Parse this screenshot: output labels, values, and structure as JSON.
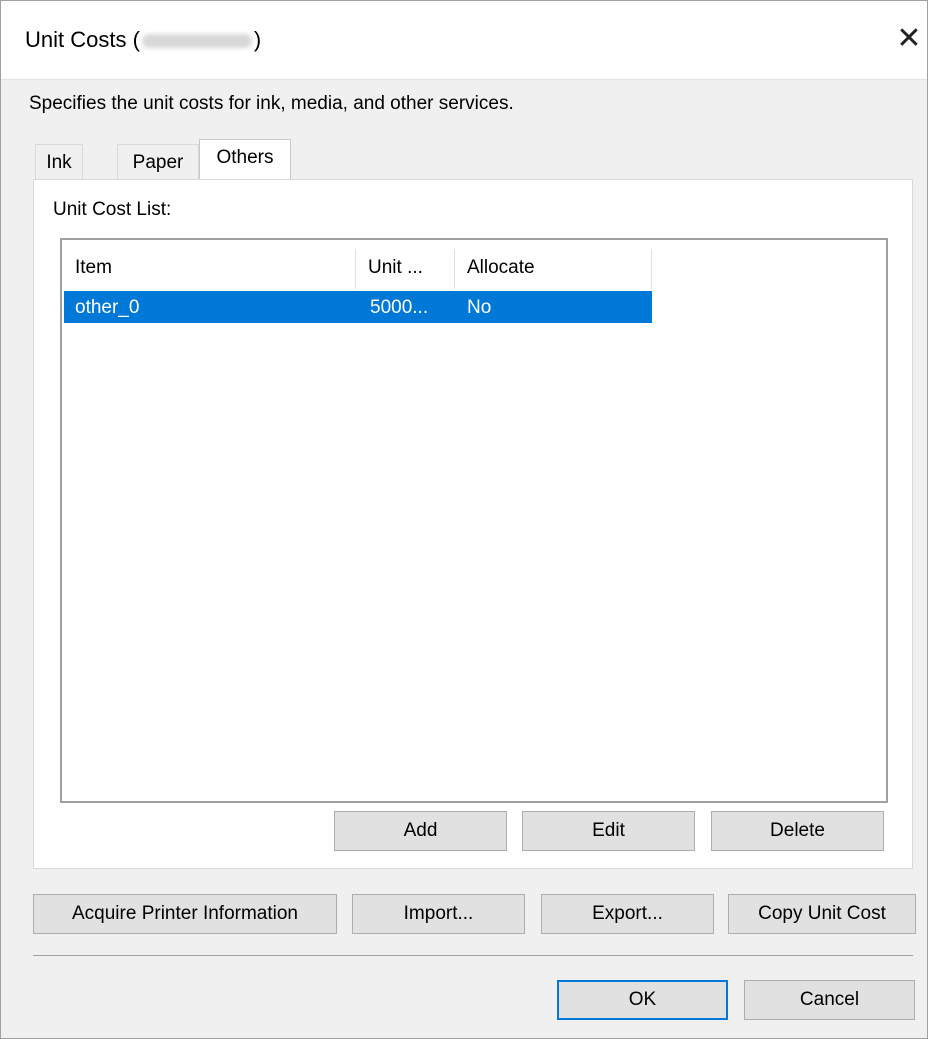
{
  "window": {
    "title_prefix": "Unit Costs (",
    "title_suffix": ")",
    "close_glyph": "✕"
  },
  "description": "Specifies the unit costs for ink, media, and other services.",
  "tabs": [
    {
      "label": "Ink"
    },
    {
      "label": "Paper"
    },
    {
      "label": "Others",
      "selected": true
    }
  ],
  "unit_cost_list": {
    "label": "Unit Cost List:",
    "columns": [
      "Item",
      "Unit ...",
      "Allocate"
    ],
    "rows": [
      {
        "item": "other_0",
        "unit": "5000...",
        "allocate": "No",
        "selected": true
      }
    ]
  },
  "list_buttons": {
    "add": "Add",
    "edit": "Edit",
    "delete": "Delete"
  },
  "action_buttons": {
    "acquire": "Acquire Printer Information",
    "import": "Import...",
    "export": "Export...",
    "copy": "Copy Unit Cost"
  },
  "footer_buttons": {
    "ok": "OK",
    "cancel": "Cancel"
  },
  "colors": {
    "selection": "#0078d7",
    "dialog_bg": "#f0f0f0",
    "button_bg": "#e1e1e1"
  }
}
